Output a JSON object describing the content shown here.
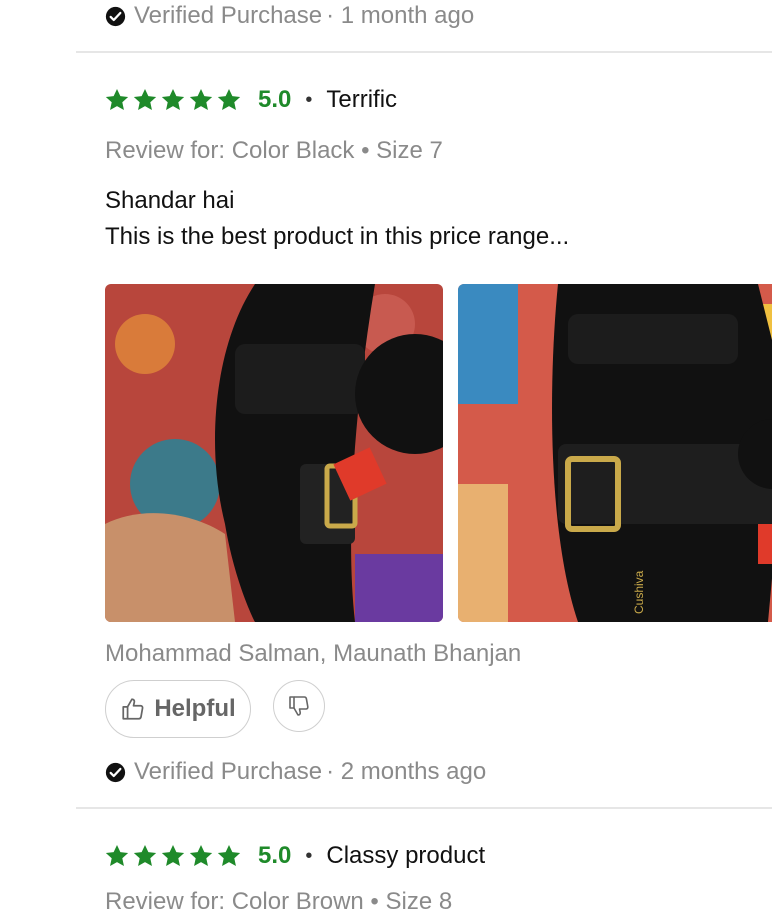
{
  "top_review": {
    "verified_label": "Verified Purchase",
    "time": "· 1 month ago"
  },
  "review1": {
    "rating": "5.0",
    "title": "Terrific",
    "review_for": "Review for: Color Black • Size 7",
    "text_line1": "Shandar hai",
    "text_line2": "This is the best product in this price range...",
    "author": "Mohammad Salman, Maunath Bhanjan",
    "helpful_label": "Helpful",
    "verified_label": "Verified Purchase",
    "time": "· 2 months ago",
    "photo_brand": "Cushiva"
  },
  "review2": {
    "rating": "5.0",
    "title": "Classy product",
    "review_for": "Review for: Color Brown • Size 8"
  },
  "colors": {
    "star": "#1f8a2a",
    "muted_text": "#8a8a8a"
  }
}
